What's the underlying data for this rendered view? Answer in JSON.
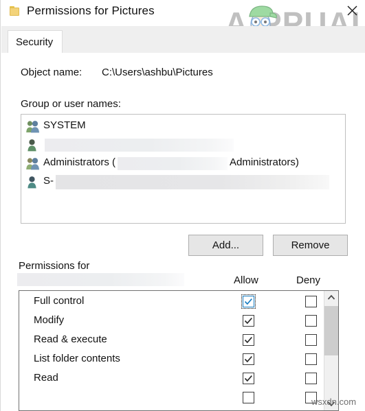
{
  "window": {
    "title": "Permissions for Pictures",
    "folder_icon": "folder-icon",
    "close_label": "✕"
  },
  "tabs": [
    {
      "label": "Security",
      "active": true
    }
  ],
  "object_name": {
    "label": "Object name:",
    "value": "C:\\Users\\ashbu\\Pictures"
  },
  "group_list": {
    "label": "Group or user names:",
    "items": [
      {
        "name": "SYSTEM",
        "icon": "group-icon",
        "redacted": false
      },
      {
        "name": "",
        "icon": "user-icon",
        "redacted": true
      },
      {
        "name": "Administrators (",
        "name_suffix": "Administrators)",
        "icon": "group-icon",
        "redacted": true
      },
      {
        "name": "S-",
        "icon": "user-icon",
        "redacted": true
      }
    ]
  },
  "buttons": {
    "add": "Add...",
    "remove": "Remove"
  },
  "permissions": {
    "label": "Permissions for",
    "subject_redacted": true,
    "columns": {
      "allow": "Allow",
      "deny": "Deny"
    },
    "rows": [
      {
        "name": "Full control",
        "allow": true,
        "deny": false,
        "focused": true
      },
      {
        "name": "Modify",
        "allow": true,
        "deny": false,
        "focused": false
      },
      {
        "name": "Read & execute",
        "allow": true,
        "deny": false,
        "focused": false
      },
      {
        "name": "List folder contents",
        "allow": true,
        "deny": false,
        "focused": false
      },
      {
        "name": "Read",
        "allow": true,
        "deny": false,
        "focused": false
      }
    ],
    "scrollbar": {
      "up_icon": "chevron-up-icon",
      "down_icon": "chevron-down-icon",
      "thumb_position": "near-top"
    }
  },
  "watermarks": {
    "brand": "APPUALS",
    "site": "wsxdn.com"
  },
  "colors": {
    "accent_blue": "#1b7fc4",
    "dialog_bg": "#ffffff",
    "tabstrip_bg": "#efefef",
    "button_bg": "#e6e6e6",
    "border": "#bfbfbf",
    "folder_yellow": "#f3d37a"
  }
}
